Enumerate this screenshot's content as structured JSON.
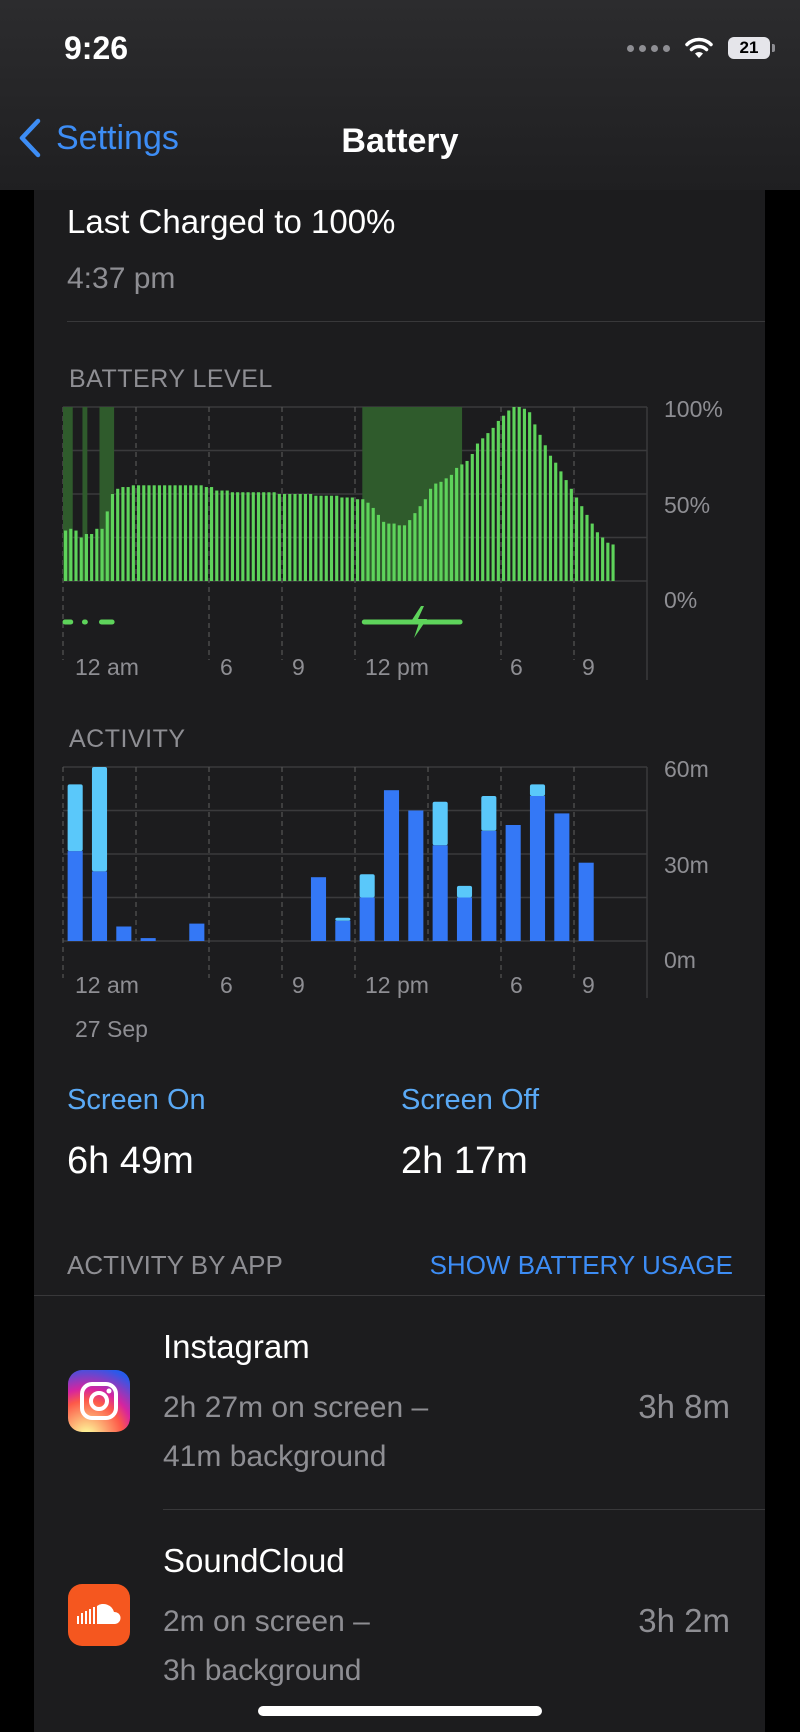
{
  "status_bar": {
    "time": "9:26",
    "battery": "21"
  },
  "nav": {
    "back_label": "Settings",
    "title": "Battery"
  },
  "last_charged": {
    "title": "Last Charged to 100%",
    "time": "4:37 pm"
  },
  "battery_level": {
    "label": "BATTERY LEVEL",
    "y_ticks": [
      "100%",
      "50%",
      "0%"
    ],
    "x_ticks": [
      "12 am",
      "6",
      "9",
      "12 pm",
      "6",
      "9"
    ]
  },
  "activity": {
    "label": "ACTIVITY",
    "y_ticks": [
      "60m",
      "30m",
      "0m"
    ],
    "x_ticks": [
      "12 am",
      "6",
      "9",
      "12 pm",
      "6",
      "9"
    ],
    "date": "27 Sep"
  },
  "chart_data": [
    {
      "type": "bar",
      "title": "BATTERY LEVEL",
      "ylabel": "",
      "ylim": [
        0,
        100
      ],
      "y_ticks": [
        "0%",
        "50%",
        "100%"
      ],
      "x_ticks": [
        "12 am",
        "6",
        "9",
        "12 pm",
        "6",
        "9"
      ],
      "bar_color": "#5ed35b",
      "charging_color": "#2f5b2c",
      "values": [
        29,
        30,
        29,
        25,
        27,
        27,
        30,
        30,
        40,
        50,
        53,
        54,
        54,
        55,
        55,
        55,
        55,
        55,
        55,
        55,
        55,
        55,
        55,
        55,
        55,
        55,
        55,
        54,
        54,
        52,
        52,
        52,
        51,
        51,
        51,
        51,
        51,
        51,
        51,
        51,
        51,
        50,
        50,
        50,
        50,
        50,
        50,
        50,
        49,
        49,
        49,
        49,
        49,
        48,
        48,
        48,
        47,
        47,
        45,
        42,
        38,
        34,
        33,
        33,
        32,
        32,
        35,
        39,
        43,
        47,
        53,
        56,
        57,
        59,
        61,
        65,
        67,
        69,
        73,
        79,
        82,
        85,
        88,
        92,
        95,
        98,
        100,
        100,
        99,
        97,
        90,
        84,
        78,
        72,
        68,
        63,
        58,
        53,
        48,
        43,
        38,
        33,
        28,
        25,
        22,
        21
      ],
      "charging_ranges_hours": [
        [
          0,
          0.4
        ],
        [
          0.8,
          1.0
        ],
        [
          1.5,
          2.1
        ],
        [
          12.3,
          16.4
        ]
      ]
    },
    {
      "type": "bar",
      "title": "ACTIVITY",
      "ylim": [
        0,
        60
      ],
      "y_ticks": [
        "0m",
        "30m",
        "60m"
      ],
      "x_ticks": [
        "12 am",
        "6",
        "9",
        "12 pm",
        "6",
        "9"
      ],
      "x_hours": [
        0,
        1,
        2,
        3,
        5,
        10,
        11,
        12,
        13,
        14,
        15,
        16,
        17,
        18,
        19,
        20,
        21
      ],
      "series": [
        {
          "name": "Screen On",
          "color": "#3478f6",
          "values": [
            31,
            24,
            5,
            1,
            6,
            22,
            7,
            15,
            52,
            45,
            33,
            15,
            38,
            40,
            50,
            44,
            27
          ]
        },
        {
          "name": "Screen Off",
          "color": "#5ac8fa",
          "values": [
            23,
            36,
            0,
            0,
            0,
            0,
            1,
            8,
            0,
            0,
            15,
            4,
            12,
            0,
            4,
            0,
            0
          ]
        }
      ]
    }
  ],
  "summary": {
    "screen_on_label": "Screen On",
    "screen_on_value": "6h 49m",
    "screen_off_label": "Screen Off",
    "screen_off_value": "2h 17m"
  },
  "activity_by_app": {
    "label": "ACTIVITY BY APP",
    "link": "SHOW BATTERY USAGE",
    "apps": [
      {
        "name": "Instagram",
        "line1": "2h 27m on screen –",
        "line2": "41m background",
        "time": "3h 8m"
      },
      {
        "name": "SoundCloud",
        "line1": "2m on screen –",
        "line2": "3h background",
        "time": "3h 2m"
      }
    ]
  }
}
